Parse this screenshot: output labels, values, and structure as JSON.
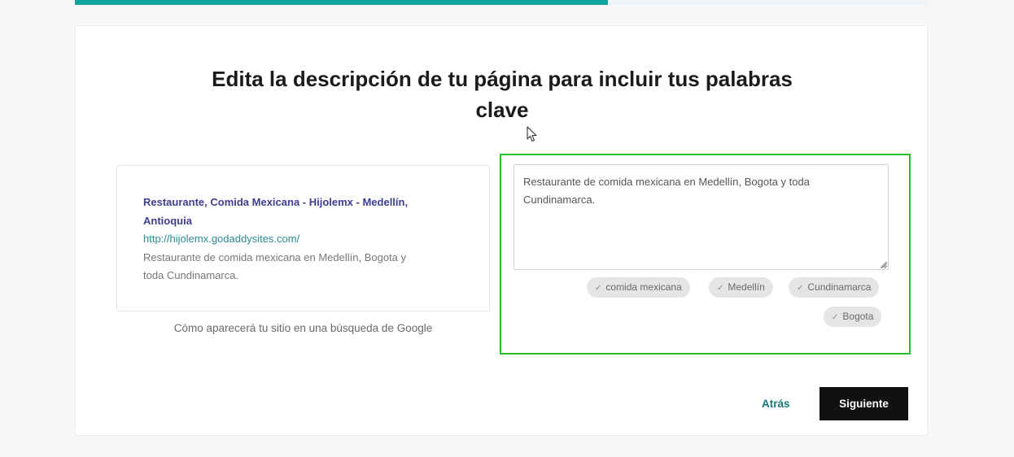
{
  "progress": {
    "fraction": 0.625
  },
  "page": {
    "title_line1": "Edita la descripción de tu página para incluir tus palabras",
    "title_line2": "clave"
  },
  "preview": {
    "title_line1": "Restaurante, Comida Mexicana - Hijolemx - Medellín,",
    "title_line2": "Antioquia",
    "url": "http://hijolemx.godaddysites.com/",
    "desc_line1": "Restaurante de comida mexicana en Medellín, Bogota y",
    "desc_line2": "toda Cundinamarca.",
    "caption": "Cómo aparecerá tu sitio en una búsqueda de Google"
  },
  "editor": {
    "value": "Restaurante de comida mexicana en Medellín, Bogota y toda Cundinamarca."
  },
  "keywords": [
    {
      "label": "comida mexicana",
      "icon": "check-icon"
    },
    {
      "label": "Medellín",
      "icon": "check-icon"
    },
    {
      "label": "Cundinamarca",
      "icon": "check-icon"
    },
    {
      "label": "Bogota",
      "icon": "check-icon"
    }
  ],
  "actions": {
    "back_label": "Atrás",
    "next_label": "Siguiente"
  },
  "colors": {
    "progress": "#12a5a0",
    "highlight": "#27c12a",
    "link": "#137a7b",
    "preview_title": "#3e3d8f",
    "primary_button": "#111111"
  }
}
